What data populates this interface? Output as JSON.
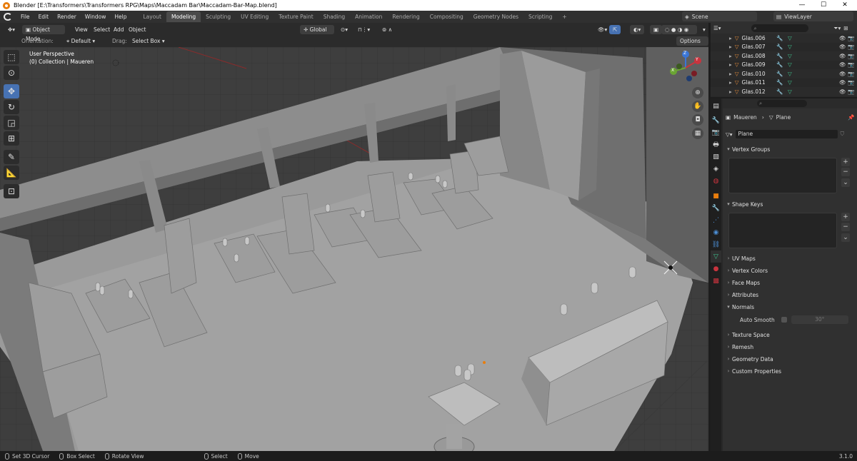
{
  "window": {
    "title": "Blender [E:\\Transformers\\Transformers RPG\\Maps\\Maccadam Bar\\Maccadam-Bar-Map.blend]",
    "controls": [
      "—",
      "☐",
      "✕"
    ]
  },
  "menu": [
    "File",
    "Edit",
    "Render",
    "Window",
    "Help"
  ],
  "workspaces": [
    "Layout",
    "Modeling",
    "Sculpting",
    "UV Editing",
    "Texture Paint",
    "Shading",
    "Animation",
    "Rendering",
    "Compositing",
    "Geometry Nodes",
    "Scripting",
    "+"
  ],
  "active_workspace": "Modeling",
  "scene": "Scene",
  "view_layer": "ViewLayer",
  "viewport_header": {
    "mode": "Object Mode",
    "view": "View",
    "select": "Select",
    "add": "Add",
    "object": "Object",
    "transform": "Global",
    "orientation_label": "Orientation:",
    "orientation_value": "Default",
    "drag_label": "Drag:",
    "drag_value": "Select Box",
    "options": "Options"
  },
  "viewport": {
    "perspective": "User Perspective",
    "collection": "(0) Collection | Maueren"
  },
  "gizmo": {
    "z": "Z",
    "y": "Y",
    "x": "X"
  },
  "outliner_rows": [
    "Glas.006",
    "Glas.007",
    "Glas.008",
    "Glas.009",
    "Glas.010",
    "Glas.011",
    "Glas.012"
  ],
  "properties": {
    "breadcrumb_object": "Maueren",
    "breadcrumb_data": "Plane",
    "mesh_name": "Plane",
    "panels": {
      "vertex_groups": "Vertex Groups",
      "shape_keys": "Shape Keys",
      "uv_maps": "UV Maps",
      "vertex_colors": "Vertex Colors",
      "face_maps": "Face Maps",
      "attributes": "Attributes",
      "normals": "Normals",
      "auto_smooth": "Auto Smooth",
      "auto_smooth_angle": "30°",
      "texture_space": "Texture Space",
      "remesh": "Remesh",
      "geometry_data": "Geometry Data",
      "custom_properties": "Custom Properties"
    }
  },
  "status": {
    "cursor": "Set 3D Cursor",
    "box": "Box Select",
    "rotate": "Rotate View",
    "select": "Select",
    "move": "Move",
    "version": "3.1.0"
  },
  "colors": {
    "accent": "#4772b3",
    "orange": "#e87d0d",
    "mesh_green": "#3fc58f"
  }
}
